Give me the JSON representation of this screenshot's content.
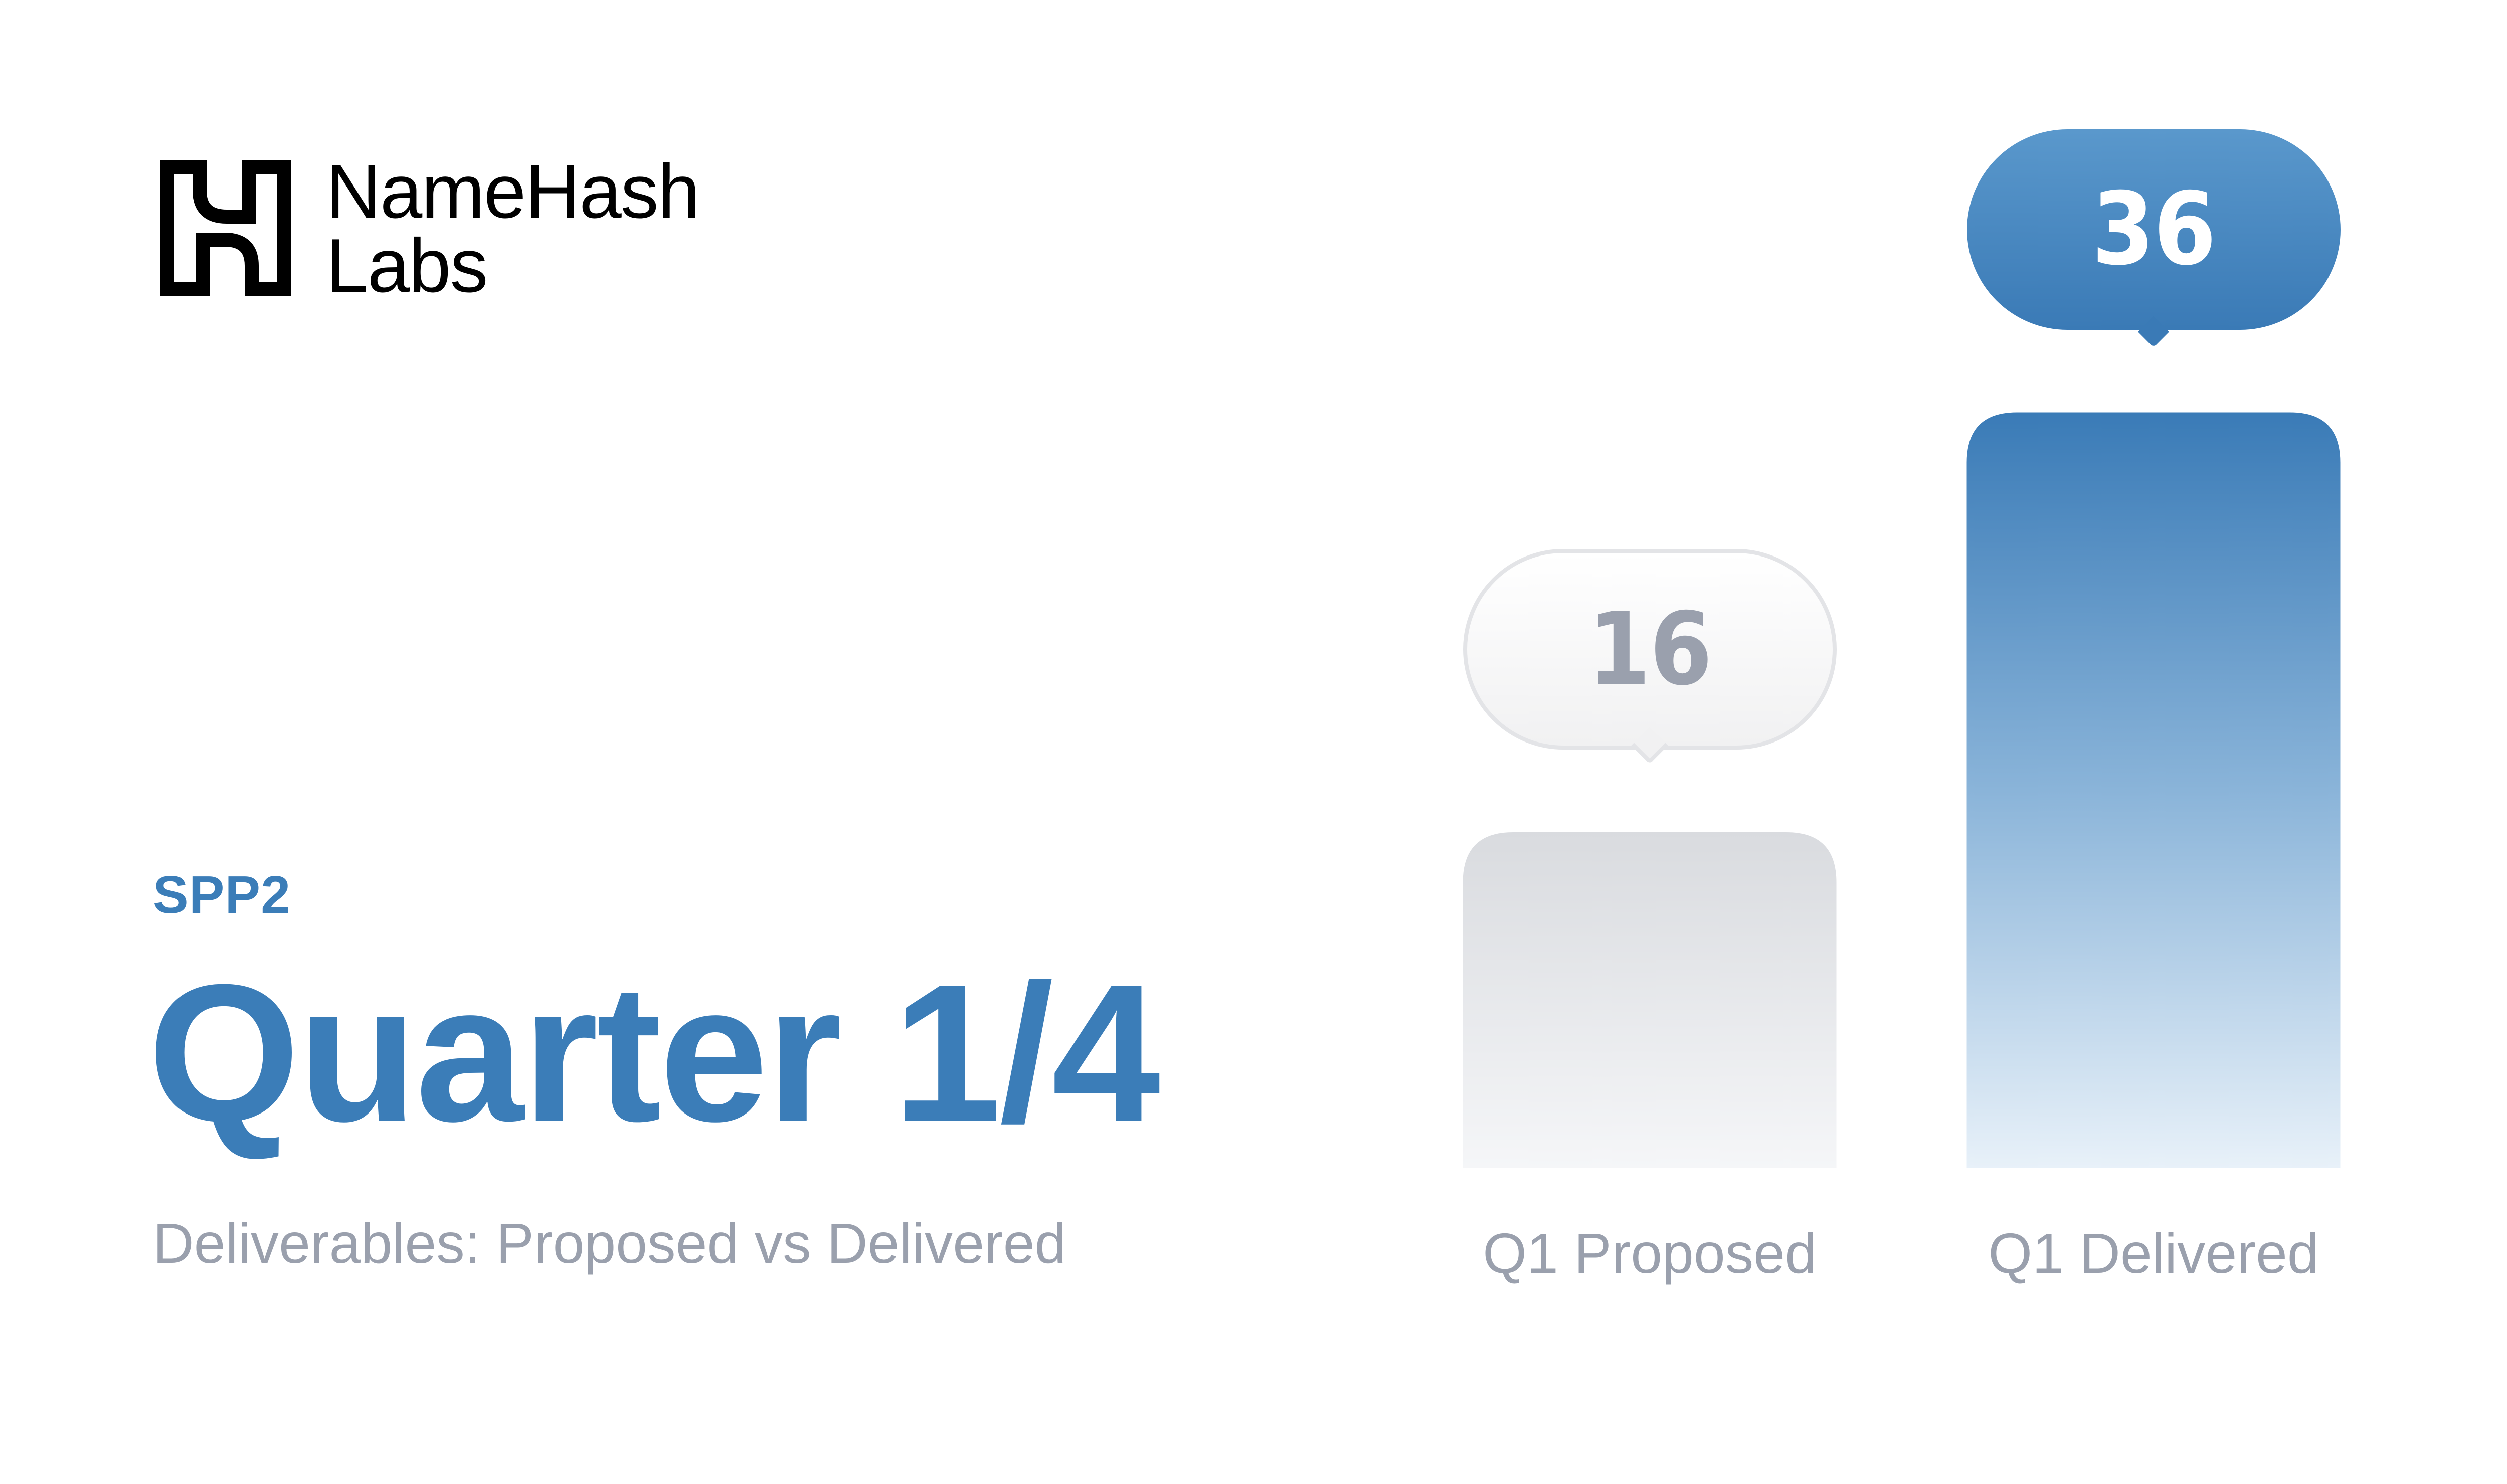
{
  "brand": {
    "name_line1": "NameHash",
    "name_line2": "Labs",
    "logo_icon": "namehash-logo-icon"
  },
  "eyebrow": "SPP2",
  "title": "Quarter 1/4",
  "subtitle": "Deliverables: Proposed vs Delivered",
  "colors": {
    "accent": "#3b7db8",
    "muted_text": "#9aa0ad",
    "grey_bar_top": "#d9dbdf",
    "blue_bar_top": "#3a7bb7",
    "gridline": "#dfe8f0"
  },
  "chart_data": {
    "type": "bar",
    "categories": [
      "Q1 Proposed",
      "Q1 Delivered"
    ],
    "values": [
      16,
      36
    ],
    "data_labels": [
      "16",
      "36"
    ],
    "ylim": [
      0,
      40
    ],
    "grid": true
  }
}
